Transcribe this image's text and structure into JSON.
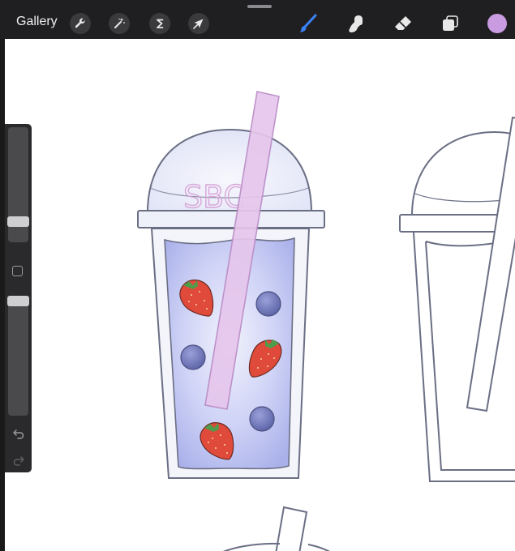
{
  "toolbar": {
    "gallery_label": "Gallery",
    "actions_icon": "wrench-icon",
    "adjustments_icon": "magic-wand-icon",
    "selection_icon": "selection-s-icon",
    "transform_icon": "arrow-cursor-icon",
    "brush_icon": "brush-icon",
    "smudge_icon": "smudge-icon",
    "eraser_icon": "eraser-icon",
    "layers_icon": "layers-icon",
    "active_tool": "brush",
    "active_tool_color": "#3b82f6",
    "current_color": "#c99be0"
  },
  "sidebar": {
    "brush_size_level": 0.15,
    "opacity_level": 1.0,
    "undo_icon": "undo-icon",
    "redo_icon": "redo-icon",
    "modify_icon": "square-icon"
  },
  "canvas": {
    "lettering": "SBC",
    "colors": {
      "outline": "#6b6f84",
      "lid_fill": "#eef0fa",
      "drink_fill": "#b8bff0",
      "straw_fill": "#e8c9ec",
      "straw_stroke": "#b98bc5",
      "strawberry": "#e04a3a",
      "blueberry": "#6f76b8",
      "leaf": "#4f9c4a"
    }
  }
}
